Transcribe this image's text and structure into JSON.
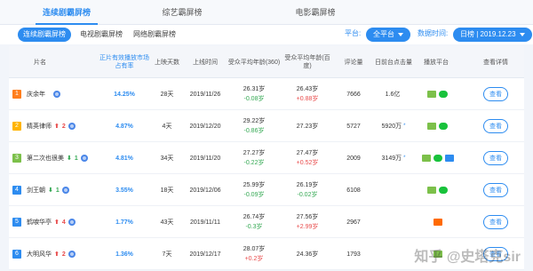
{
  "top_tabs": [
    "连续剧霸屏榜",
    "综艺霸屏榜",
    "电影霸屏榜"
  ],
  "sub_tabs": [
    "连续剧霸屏榜",
    "电视剧霸屏榜",
    "网络剧霸屏榜"
  ],
  "filters": {
    "platform_label": "平台:",
    "platform_value": "全平台",
    "date_label": "数据时间:",
    "date_value": "日榜 | 2019.12.23"
  },
  "headers": {
    "name": "片名",
    "share": "正片有效播放市场占有率",
    "days": "上映天数",
    "date": "上线时间",
    "age360": "受众平均年龄(360)",
    "ageBaidu": "受众平均年龄(百度)",
    "reviews": "评论量",
    "daily_plays": "日前台点击量",
    "platforms": "播放平台",
    "detail": "查看详情"
  },
  "rows": [
    {
      "rank": "1",
      "rank_color": "#ff7e1d",
      "title": "庆余年",
      "arrow": "",
      "arrow_num": "",
      "share": "14.25%",
      "days": "28天",
      "date": "2019/11/26",
      "age360": "26.31岁",
      "age360_change": "-0.08岁",
      "ageBaidu": "26.43岁",
      "ageBaidu_change": "+0.88岁",
      "reviews": "7666",
      "plays": "1.6亿",
      "plays_star": "",
      "detail": "查看"
    },
    {
      "rank": "2",
      "rank_color": "#ffb400",
      "title": "精英律师",
      "arrow": "⬆",
      "arrow_num": "2",
      "share": "4.87%",
      "days": "4天",
      "date": "2019/12/20",
      "age360": "29.22岁",
      "age360_change": "-0.86岁",
      "ageBaidu": "27.23岁",
      "ageBaidu_change": "",
      "reviews": "5727",
      "plays": "5920万",
      "plays_star": "*",
      "detail": "查看"
    },
    {
      "rank": "3",
      "rank_color": "#7cc04a",
      "title": "第二次也很美",
      "arrow": "⬇",
      "arrow_num": "1",
      "share": "4.81%",
      "days": "34天",
      "date": "2019/11/20",
      "age360": "27.27岁",
      "age360_change": "-0.22岁",
      "ageBaidu": "27.47岁",
      "ageBaidu_change": "+0.52岁",
      "reviews": "2009",
      "plays": "3149万",
      "plays_star": "*",
      "detail": "查看"
    },
    {
      "rank": "4",
      "rank_color": "#2d8cf0",
      "title": "剑王朝",
      "arrow": "⬇",
      "arrow_num": "1",
      "share": "3.55%",
      "days": "18天",
      "date": "2019/12/06",
      "age360": "25.99岁",
      "age360_change": "-0.09岁",
      "ageBaidu": "26.19岁",
      "ageBaidu_change": "-0.02岁",
      "reviews": "6108",
      "plays": "",
      "plays_star": "",
      "detail": "查看"
    },
    {
      "rank": "5",
      "rank_color": "#2d8cf0",
      "title": "鹤唳华亭",
      "arrow": "⬆",
      "arrow_num": "4",
      "share": "1.77%",
      "days": "43天",
      "date": "2019/11/11",
      "age360": "26.74岁",
      "age360_change": "-0.3岁",
      "ageBaidu": "27.56岁",
      "ageBaidu_change": "+2.99岁",
      "reviews": "2967",
      "plays": "",
      "plays_star": "",
      "detail": "查看"
    },
    {
      "rank": "6",
      "rank_color": "#2d8cf0",
      "title": "大明风华",
      "arrow": "⬆",
      "arrow_num": "2",
      "share": "1.36%",
      "days": "7天",
      "date": "2019/12/17",
      "age360": "28.07岁",
      "age360_change": "+0.2岁",
      "ageBaidu": "24.36岁",
      "ageBaidu_change": "",
      "reviews": "1793",
      "plays": "",
      "plays_star": "",
      "detail": "查看"
    }
  ],
  "row_platforms": [
    [
      "green",
      "iqiyi"
    ],
    [
      "green",
      "iqiyi"
    ],
    [
      "green",
      "iqiyi",
      "bili"
    ],
    [
      "green",
      "iqiyi"
    ],
    [
      "tx"
    ],
    [
      "green"
    ]
  ],
  "watermark": "知乎 @史塔克sir"
}
